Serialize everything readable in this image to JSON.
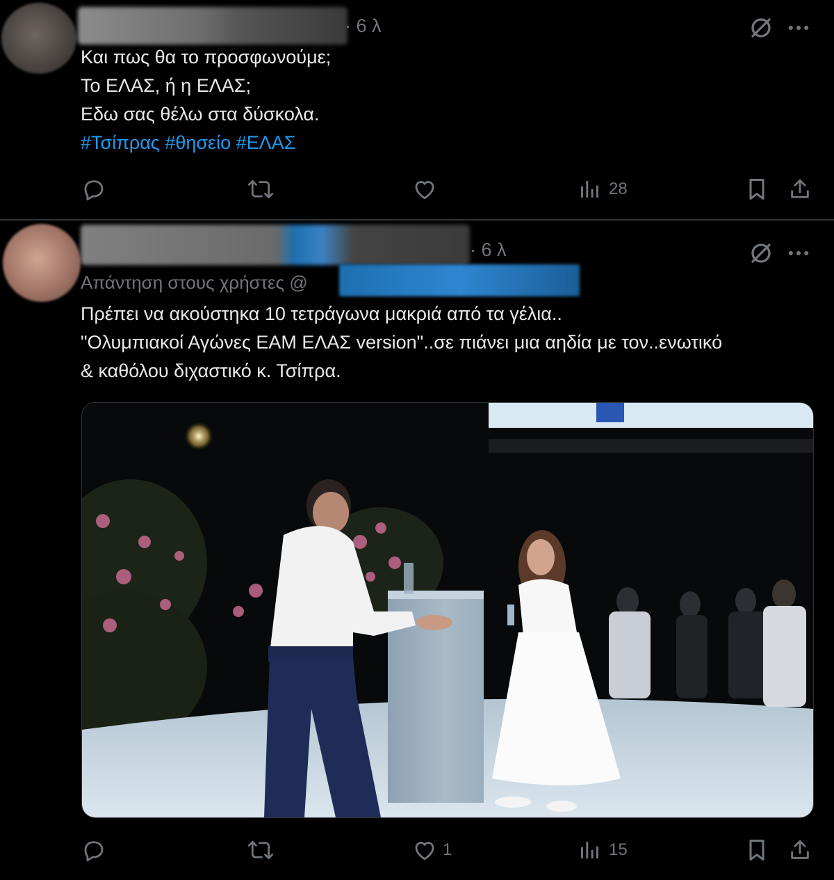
{
  "tweets": [
    {
      "time": "· 6 λ",
      "lines": [
        "Και πως θα το προσφωνούμε;",
        "Το ΕΛΑΣ, ή η ΕΛΑΣ;",
        "Εδω σας θέλω στα δύσκολα."
      ],
      "hashtags": [
        "#Τσίπρας",
        "#θησείο",
        "#ΕΛΑΣ"
      ],
      "actions": {
        "reply": "",
        "retweet": "",
        "like": "",
        "views": "28"
      },
      "icons": [
        "reply-icon",
        "retweet-icon",
        "heart-icon",
        "views-icon",
        "bookmark-icon",
        "share-icon"
      ]
    },
    {
      "time": "· 6 λ",
      "reply_to_prefix": "Απάντηση στους χρήστες @",
      "lines": [
        "Πρέπει να ακούστηκα 10 τετράγωνα μακριά από τα γέλια..",
        "\"Ολυμπιακοί Αγώνες ΕΑΜ ΕΛΑΣ version\"..σε πιάνει μια αηδία με τον..ενωτικό",
        "& καθόλου διχαστικό κ. Τσίπρα."
      ],
      "actions": {
        "reply": "",
        "retweet": "",
        "like": "1",
        "views": "15"
      },
      "icons": [
        "reply-icon",
        "retweet-icon",
        "heart-icon",
        "views-icon",
        "bookmark-icon",
        "share-icon"
      ]
    }
  ],
  "colors": {
    "background": "#000000",
    "text": "#e7e9ea",
    "muted": "#71767b",
    "link": "#1d9bf0",
    "divider": "#2f3336"
  }
}
